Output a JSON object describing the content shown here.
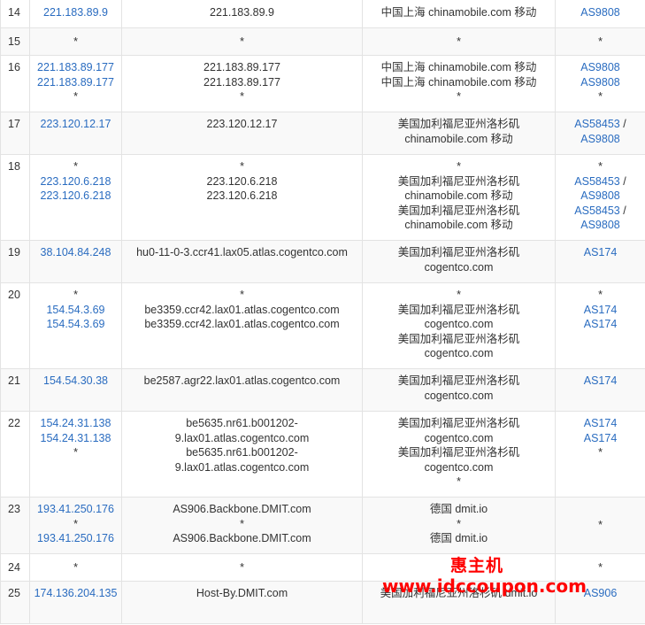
{
  "rows": [
    {
      "hop": "14",
      "ip": [
        "221.183.89.9"
      ],
      "host": [
        "221.183.89.9"
      ],
      "loc": [
        "中国上海 chinamobile.com 移动"
      ],
      "asn": [
        "AS9808"
      ]
    },
    {
      "hop": "15",
      "ip": [
        "*"
      ],
      "host": [
        "*"
      ],
      "loc": [
        "*"
      ],
      "asn": [
        "*"
      ]
    },
    {
      "hop": "16",
      "ip": [
        "221.183.89.177",
        "221.183.89.177",
        "*"
      ],
      "host": [
        "221.183.89.177",
        "221.183.89.177",
        "*"
      ],
      "loc": [
        "中国上海 chinamobile.com 移动",
        "中国上海 chinamobile.com 移动",
        "*"
      ],
      "asn": [
        "AS9808",
        "AS9808",
        "*"
      ]
    },
    {
      "hop": "17",
      "ip": [
        "223.120.12.17"
      ],
      "host": [
        "223.120.12.17"
      ],
      "loc": [
        "美国加利福尼亚州洛杉矶",
        "chinamobile.com 移动"
      ],
      "asn": [
        "AS58453 /",
        "AS9808"
      ]
    },
    {
      "hop": "18",
      "ip": [
        "*",
        "223.120.6.218",
        "223.120.6.218"
      ],
      "host": [
        "*",
        "223.120.6.218",
        "223.120.6.218"
      ],
      "loc": [
        "*",
        "美国加利福尼亚州洛杉矶",
        "chinamobile.com 移动",
        "美国加利福尼亚州洛杉矶",
        "chinamobile.com 移动"
      ],
      "asn": [
        "*",
        "AS58453 /",
        "AS9808",
        "AS58453 /",
        "AS9808"
      ]
    },
    {
      "hop": "19",
      "ip": [
        "38.104.84.248"
      ],
      "host": [
        "hu0-11-0-3.ccr41.lax05.atlas.cogentco.com"
      ],
      "loc": [
        "美国加利福尼亚州洛杉矶",
        "cogentco.com"
      ],
      "asn": [
        "AS174"
      ]
    },
    {
      "hop": "20",
      "ip": [
        "*",
        "154.54.3.69",
        "154.54.3.69"
      ],
      "host": [
        "*",
        "be3359.ccr42.lax01.atlas.cogentco.com",
        "be3359.ccr42.lax01.atlas.cogentco.com"
      ],
      "loc": [
        "*",
        "美国加利福尼亚州洛杉矶",
        "cogentco.com",
        "美国加利福尼亚州洛杉矶",
        "cogentco.com"
      ],
      "asn": [
        "*",
        "AS174",
        "AS174"
      ]
    },
    {
      "hop": "21",
      "ip": [
        "154.54.30.38"
      ],
      "host": [
        "be2587.agr22.lax01.atlas.cogentco.com"
      ],
      "loc": [
        "美国加利福尼亚州洛杉矶",
        "cogentco.com"
      ],
      "asn": [
        "AS174"
      ]
    },
    {
      "hop": "22",
      "ip": [
        "154.24.31.138",
        "154.24.31.138",
        "*"
      ],
      "host": [
        "be5635.nr61.b001202-",
        "9.lax01.atlas.cogentco.com",
        "be5635.nr61.b001202-",
        "9.lax01.atlas.cogentco.com"
      ],
      "loc": [
        "美国加利福尼亚州洛杉矶",
        "cogentco.com",
        "美国加利福尼亚州洛杉矶",
        "cogentco.com",
        "*"
      ],
      "asn": [
        "AS174",
        "AS174",
        "*"
      ]
    },
    {
      "hop": "23",
      "ip": [
        "193.41.250.176",
        "*",
        "193.41.250.176"
      ],
      "host": [
        "AS906.Backbone.DMIT.com",
        "*",
        "AS906.Backbone.DMIT.com"
      ],
      "loc": [
        "德国 dmit.io",
        "*",
        "德国 dmit.io"
      ],
      "asn": [
        "*"
      ]
    },
    {
      "hop": "24",
      "ip": [
        "*"
      ],
      "host": [
        "*"
      ],
      "loc": [
        "*"
      ],
      "asn": [
        "*"
      ]
    },
    {
      "hop": "25",
      "ip": [
        "174.136.204.135"
      ],
      "host": [
        "Host-By.DMIT.com"
      ],
      "loc": [
        "美国加利福尼亚州洛杉矶 dmit.io"
      ],
      "asn": [
        "AS906"
      ]
    }
  ],
  "watermark": {
    "brand": "惠主机",
    "url": "www.idccoupon.com"
  },
  "colors": {
    "link": "#2a6cc0",
    "watermark": "#ff0000",
    "stripe": "#f9f9f9",
    "border": "#e3e3e3"
  }
}
